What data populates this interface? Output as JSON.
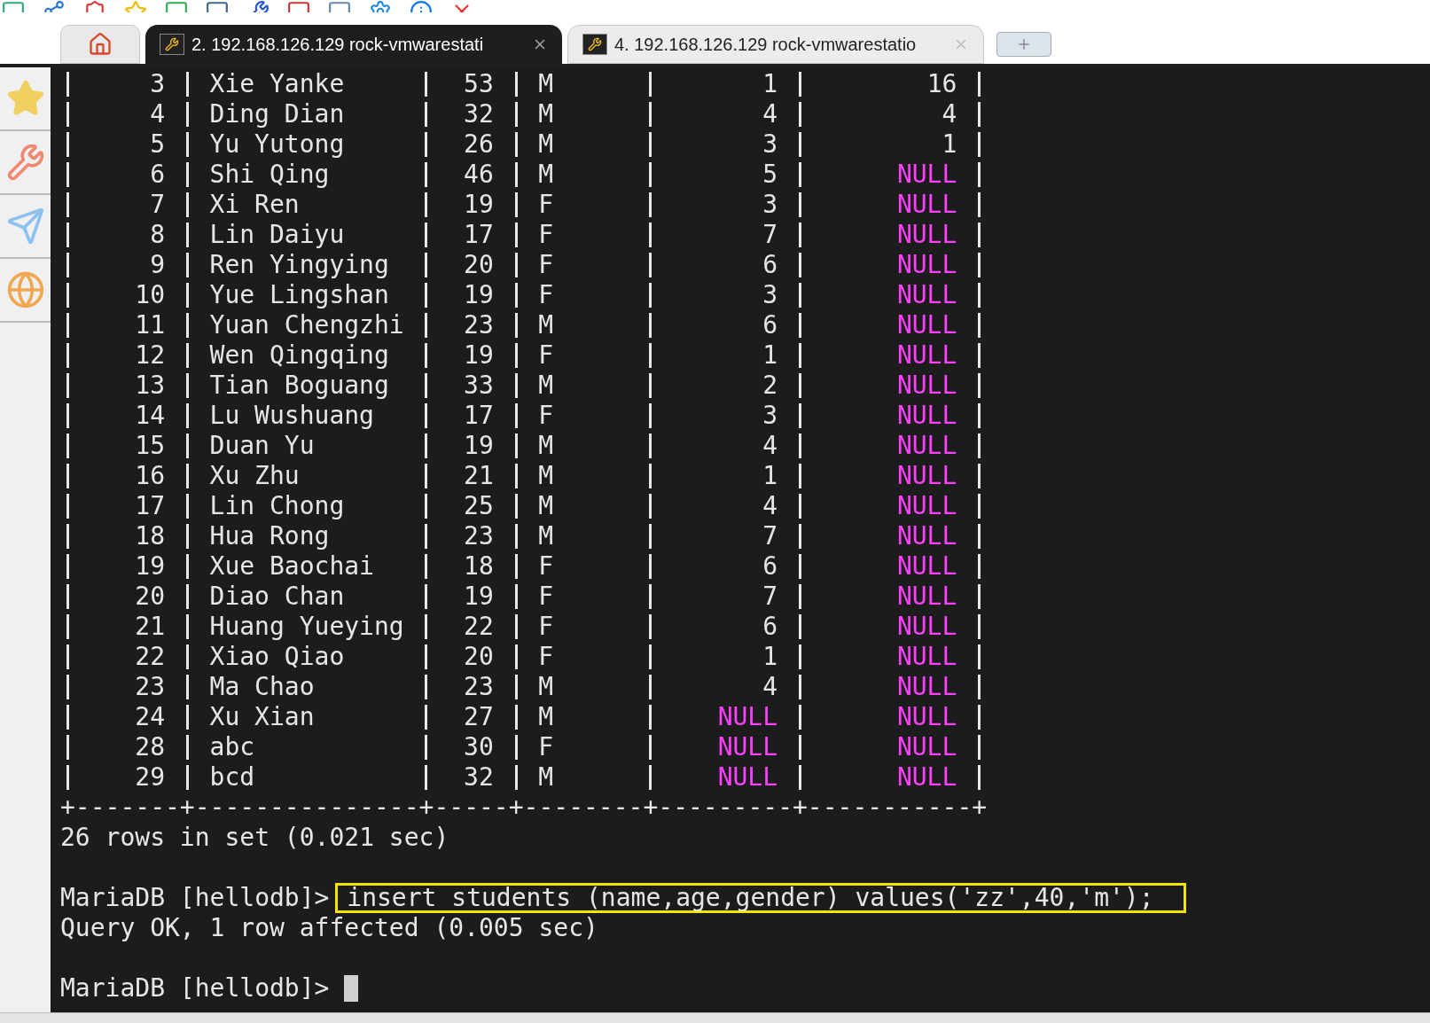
{
  "tabs": [
    {
      "kind": "home",
      "selected": false
    },
    {
      "kind": "session",
      "label": "2. 192.168.126.129 rock-vmwarestati",
      "selected": true
    },
    {
      "kind": "session",
      "label": "4. 192.168.126.129 rock-vmwarestatio",
      "selected": false
    }
  ],
  "terminal": {
    "rows": [
      {
        "id": "3",
        "name": "Xie Yanke",
        "age": "53",
        "gender": "M",
        "column_5": {
          "text": "1",
          "kind": "value"
        },
        "column_6": {
          "text": "16",
          "kind": "value"
        }
      },
      {
        "id": "4",
        "name": "Ding Dian",
        "age": "32",
        "gender": "M",
        "column_5": {
          "text": "4",
          "kind": "value"
        },
        "column_6": {
          "text": "4",
          "kind": "value"
        }
      },
      {
        "id": "5",
        "name": "Yu Yutong",
        "age": "26",
        "gender": "M",
        "column_5": {
          "text": "3",
          "kind": "value"
        },
        "column_6": {
          "text": "1",
          "kind": "value"
        }
      },
      {
        "id": "6",
        "name": "Shi Qing",
        "age": "46",
        "gender": "M",
        "column_5": {
          "text": "5",
          "kind": "value"
        },
        "column_6": {
          "text": "NULL",
          "kind": "null"
        }
      },
      {
        "id": "7",
        "name": "Xi Ren",
        "age": "19",
        "gender": "F",
        "column_5": {
          "text": "3",
          "kind": "value"
        },
        "column_6": {
          "text": "NULL",
          "kind": "null"
        }
      },
      {
        "id": "8",
        "name": "Lin Daiyu",
        "age": "17",
        "gender": "F",
        "column_5": {
          "text": "7",
          "kind": "value"
        },
        "column_6": {
          "text": "NULL",
          "kind": "null"
        }
      },
      {
        "id": "9",
        "name": "Ren Yingying",
        "age": "20",
        "gender": "F",
        "column_5": {
          "text": "6",
          "kind": "value"
        },
        "column_6": {
          "text": "NULL",
          "kind": "null"
        }
      },
      {
        "id": "10",
        "name": "Yue Lingshan",
        "age": "19",
        "gender": "F",
        "column_5": {
          "text": "3",
          "kind": "value"
        },
        "column_6": {
          "text": "NULL",
          "kind": "null"
        }
      },
      {
        "id": "11",
        "name": "Yuan Chengzhi",
        "age": "23",
        "gender": "M",
        "column_5": {
          "text": "6",
          "kind": "value"
        },
        "column_6": {
          "text": "NULL",
          "kind": "null"
        }
      },
      {
        "id": "12",
        "name": "Wen Qingqing",
        "age": "19",
        "gender": "F",
        "column_5": {
          "text": "1",
          "kind": "value"
        },
        "column_6": {
          "text": "NULL",
          "kind": "null"
        }
      },
      {
        "id": "13",
        "name": "Tian Boguang",
        "age": "33",
        "gender": "M",
        "column_5": {
          "text": "2",
          "kind": "value"
        },
        "column_6": {
          "text": "NULL",
          "kind": "null"
        }
      },
      {
        "id": "14",
        "name": "Lu Wushuang",
        "age": "17",
        "gender": "F",
        "column_5": {
          "text": "3",
          "kind": "value"
        },
        "column_6": {
          "text": "NULL",
          "kind": "null"
        }
      },
      {
        "id": "15",
        "name": "Duan Yu",
        "age": "19",
        "gender": "M",
        "column_5": {
          "text": "4",
          "kind": "value"
        },
        "column_6": {
          "text": "NULL",
          "kind": "null"
        }
      },
      {
        "id": "16",
        "name": "Xu Zhu",
        "age": "21",
        "gender": "M",
        "column_5": {
          "text": "1",
          "kind": "value"
        },
        "column_6": {
          "text": "NULL",
          "kind": "null"
        }
      },
      {
        "id": "17",
        "name": "Lin Chong",
        "age": "25",
        "gender": "M",
        "column_5": {
          "text": "4",
          "kind": "value"
        },
        "column_6": {
          "text": "NULL",
          "kind": "null"
        }
      },
      {
        "id": "18",
        "name": "Hua Rong",
        "age": "23",
        "gender": "M",
        "column_5": {
          "text": "7",
          "kind": "value"
        },
        "column_6": {
          "text": "NULL",
          "kind": "null"
        }
      },
      {
        "id": "19",
        "name": "Xue Baochai",
        "age": "18",
        "gender": "F",
        "column_5": {
          "text": "6",
          "kind": "value"
        },
        "column_6": {
          "text": "NULL",
          "kind": "null"
        }
      },
      {
        "id": "20",
        "name": "Diao Chan",
        "age": "19",
        "gender": "F",
        "column_5": {
          "text": "7",
          "kind": "value"
        },
        "column_6": {
          "text": "NULL",
          "kind": "null"
        }
      },
      {
        "id": "21",
        "name": "Huang Yueying",
        "age": "22",
        "gender": "F",
        "column_5": {
          "text": "6",
          "kind": "value"
        },
        "column_6": {
          "text": "NULL",
          "kind": "null"
        }
      },
      {
        "id": "22",
        "name": "Xiao Qiao",
        "age": "20",
        "gender": "F",
        "column_5": {
          "text": "1",
          "kind": "value"
        },
        "column_6": {
          "text": "NULL",
          "kind": "null"
        }
      },
      {
        "id": "23",
        "name": "Ma Chao",
        "age": "23",
        "gender": "M",
        "column_5": {
          "text": "4",
          "kind": "value"
        },
        "column_6": {
          "text": "NULL",
          "kind": "null"
        }
      },
      {
        "id": "24",
        "name": "Xu Xian",
        "age": "27",
        "gender": "M",
        "column_5": {
          "text": "NULL",
          "kind": "null"
        },
        "column_6": {
          "text": "NULL",
          "kind": "null"
        }
      },
      {
        "id": "28",
        "name": "abc",
        "age": "30",
        "gender": "F",
        "column_5": {
          "text": "NULL",
          "kind": "null"
        },
        "column_6": {
          "text": "NULL",
          "kind": "null"
        }
      },
      {
        "id": "29",
        "name": "bcd",
        "age": "32",
        "gender": "M",
        "column_5": {
          "text": "NULL",
          "kind": "null"
        },
        "column_6": {
          "text": "NULL",
          "kind": "null"
        }
      }
    ],
    "border": "+-------+---------------+-----+--------+---------+-----------+",
    "summary": "26 rows in set (0.021 sec)",
    "commands": [
      {
        "prompt": "MariaDB [hellodb]>",
        "input": "insert students (name,age,gender) values('zz',40,'m');",
        "highlighted": true,
        "output": "Query OK, 1 row affected (0.005 sec)",
        "cursor": false
      },
      {
        "prompt": "MariaDB [hellodb]>",
        "cursor": true
      }
    ]
  }
}
